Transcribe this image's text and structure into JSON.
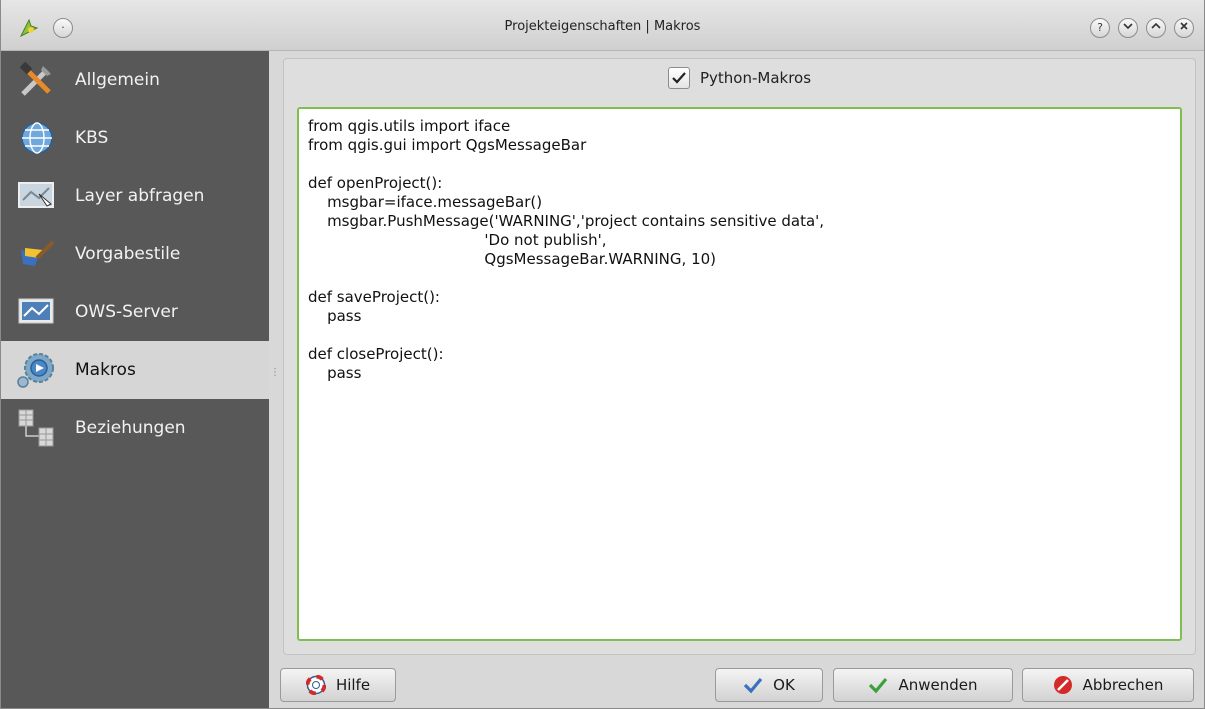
{
  "window": {
    "title": "Projekteigenschaften | Makros",
    "controls": {
      "help": "?",
      "minimize": "⌄",
      "maximize": "⌃",
      "close": "✕",
      "menu": "·"
    }
  },
  "sidebar": {
    "items": [
      {
        "label": "Allgemein",
        "icon": "tools-icon",
        "selected": false
      },
      {
        "label": "KBS",
        "icon": "globe-icon",
        "selected": false
      },
      {
        "label": "Layer abfragen",
        "icon": "map-query-icon",
        "selected": false
      },
      {
        "label": "Vorgabestile",
        "icon": "paintbrush-icon",
        "selected": false
      },
      {
        "label": "OWS-Server",
        "icon": "ows-server-icon",
        "selected": false
      },
      {
        "label": "Makros",
        "icon": "macros-gear-icon",
        "selected": true
      },
      {
        "label": "Beziehungen",
        "icon": "relations-table-icon",
        "selected": false
      }
    ]
  },
  "macros": {
    "group_label": "Python-Makros",
    "enabled": true,
    "code": "from qgis.utils import iface\nfrom qgis.gui import QgsMessageBar\n\ndef openProject():\n    msgbar=iface.messageBar()\n    msgbar.PushMessage('WARNING','project contains sensitive data',\n                                     'Do not publish',\n                                     QgsMessageBar.WARNING, 10)\n\ndef saveProject():\n    pass\n\ndef closeProject():\n    pass\n"
  },
  "buttons": {
    "help": "Hilfe",
    "ok": "OK",
    "apply": "Anwenden",
    "cancel": "Abbrechen"
  },
  "colors": {
    "sidebar_bg": "#585858",
    "editor_focus_border": "#7fbf50",
    "cancel_red": "#d42a2a",
    "check_blue": "#3b6fbf",
    "apply_green": "#3ca13c"
  }
}
